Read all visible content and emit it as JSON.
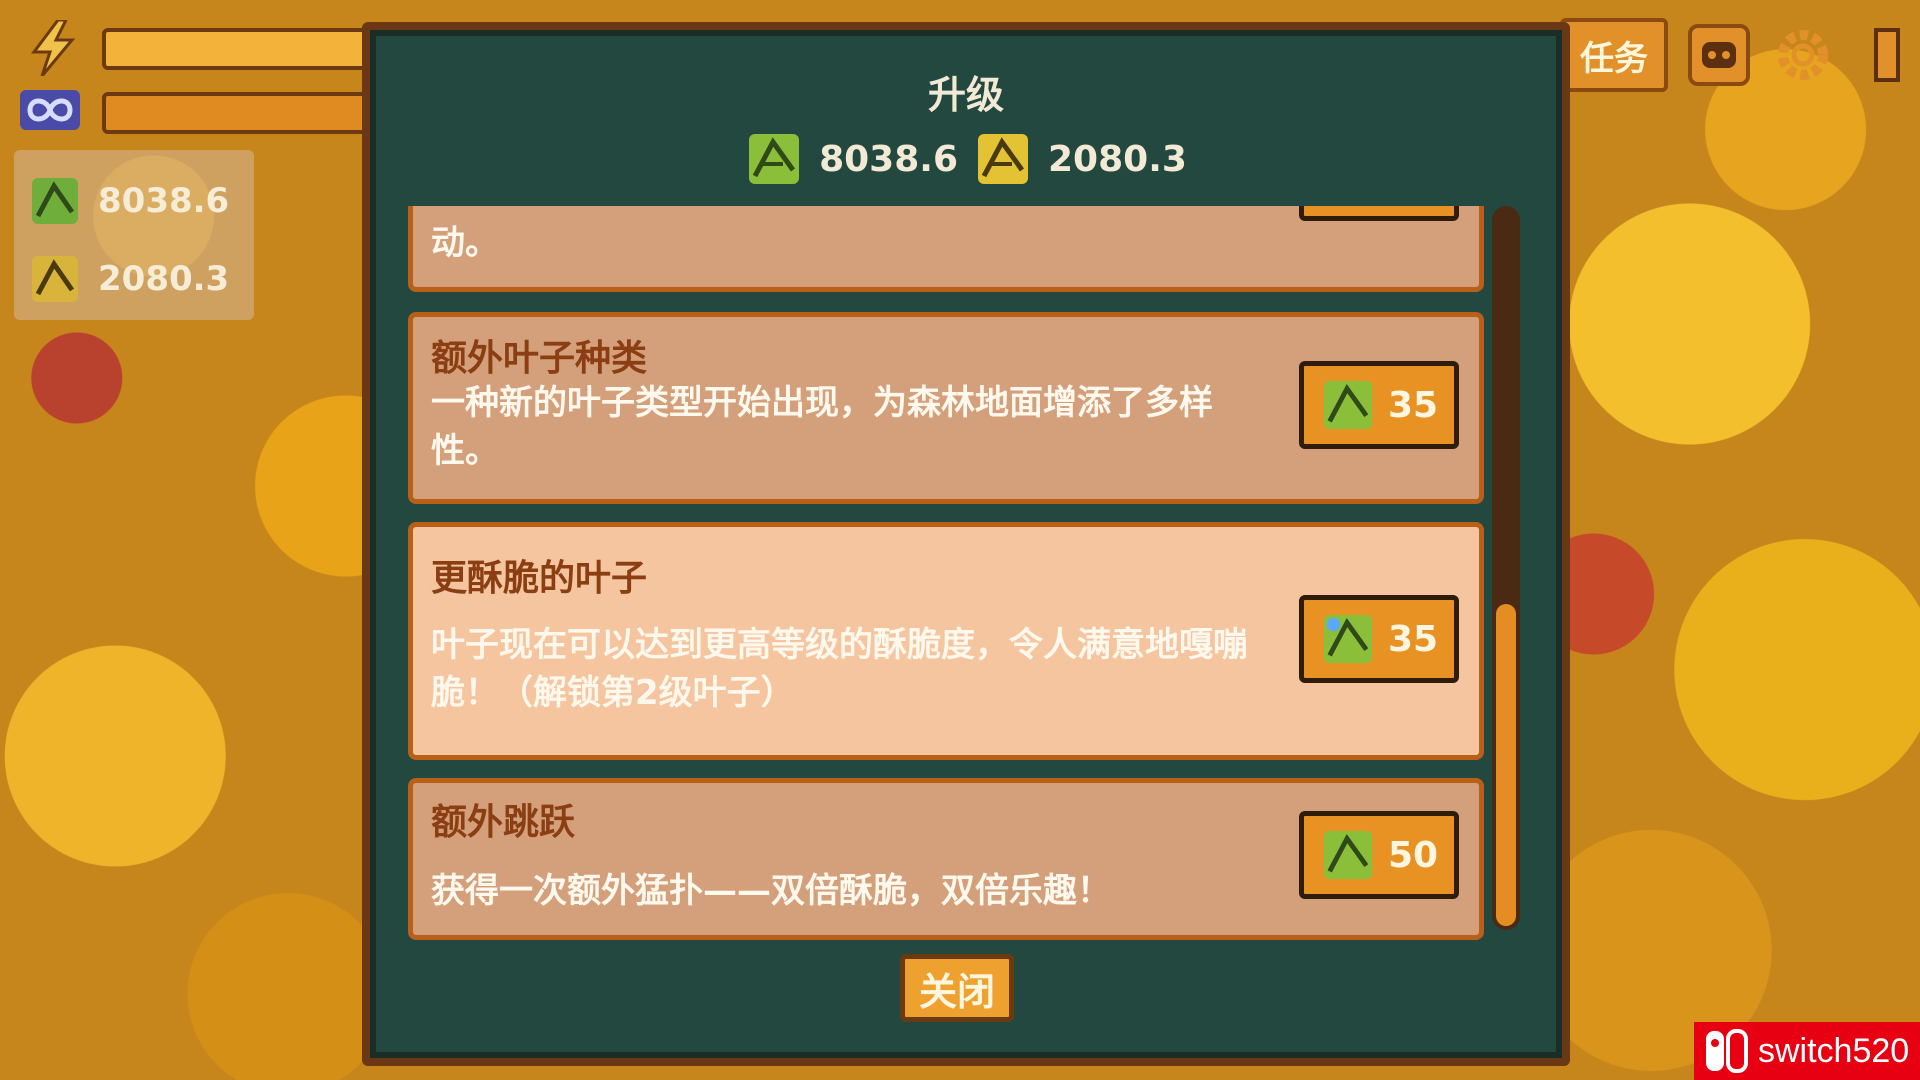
{
  "hud": {
    "leaf_total_1": "8038.6",
    "leaf_total_2": "2080.3",
    "quest_label": "任务"
  },
  "dialog": {
    "title": "升级",
    "currency_1": "8038.6",
    "currency_2": "2080.3",
    "close_label": "关闭"
  },
  "upgrades": [
    {
      "title": "",
      "desc": "动。",
      "price": ""
    },
    {
      "title": "额外叶子种类",
      "desc": "一种新的叶子类型开始出现，为森林地面增添了多样性。",
      "price": "35"
    },
    {
      "title": "更酥脆的叶子",
      "desc": "叶子现在可以达到更高等级的酥脆度，令人满意地嘎嘣脆！（解锁第2级叶子）",
      "price": "35"
    },
    {
      "title": "额外跳跃",
      "desc": "获得一次额外猛扑——双倍酥脆，双倍乐趣！",
      "price": "50"
    }
  ],
  "watermark": {
    "text": "switch520"
  },
  "colors": {
    "panel": "#234840",
    "card": "#d4a07c",
    "card_highlight": "#f5c59f",
    "button": "#e99224"
  }
}
